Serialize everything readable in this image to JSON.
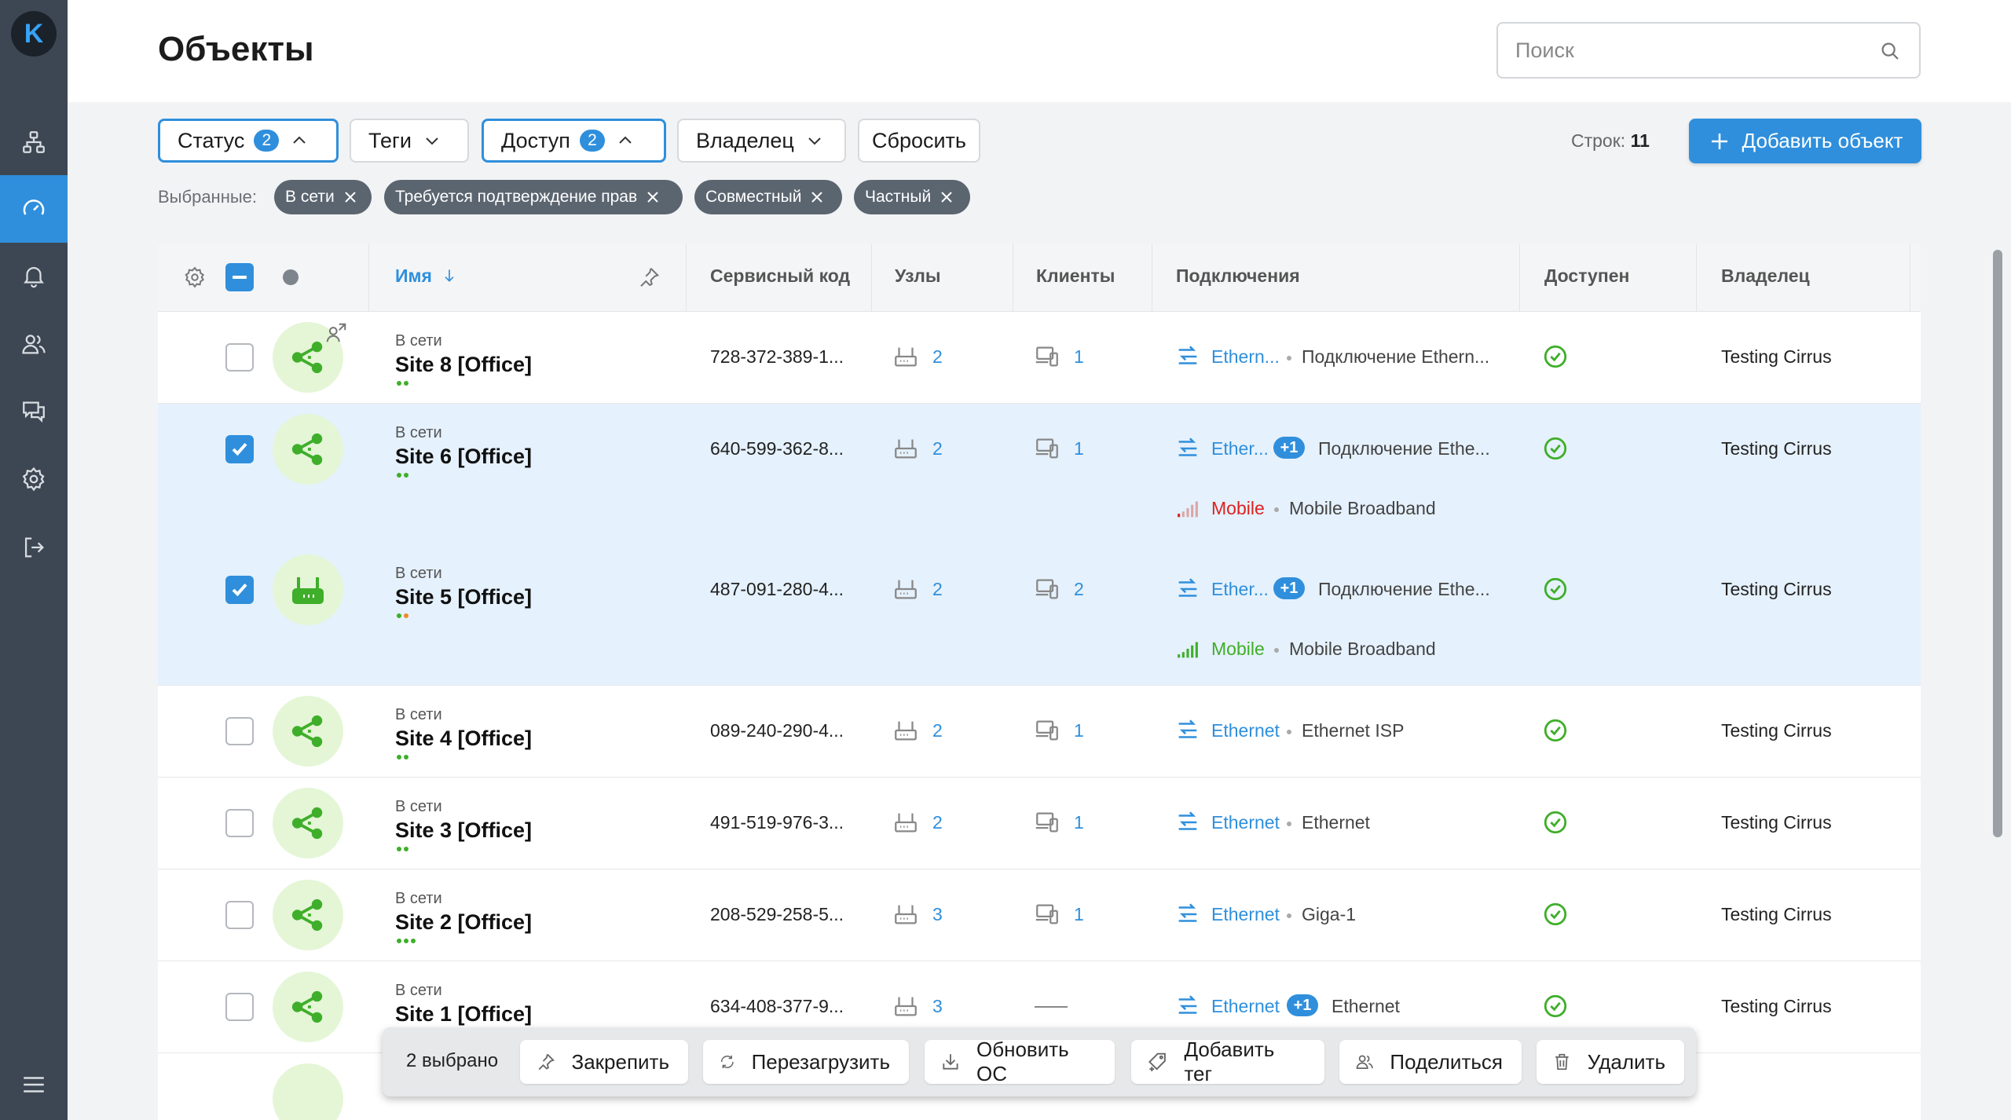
{
  "app": {
    "logo_letter": "K"
  },
  "header": {
    "title": "Объекты",
    "search_placeholder": "Поиск"
  },
  "filters": {
    "status": {
      "label": "Статус",
      "count": "2"
    },
    "tags": {
      "label": "Теги"
    },
    "access": {
      "label": "Доступ",
      "count": "2"
    },
    "owner": {
      "label": "Владелец"
    },
    "reset": "Сбросить",
    "rows_label": "Строк:",
    "rows_value": "11",
    "add_label": "Добавить объект"
  },
  "selected": {
    "label": "Выбранные:",
    "tags": [
      "В сети",
      "Требуется подтверждение прав",
      "Совместный",
      "Частный"
    ]
  },
  "table": {
    "columns": {
      "name": "Имя",
      "service_code": "Сервисный код",
      "nodes": "Узлы",
      "clients": "Клиенты",
      "connections": "Подключения",
      "available": "Доступен",
      "owner": "Владелец"
    },
    "rows": [
      {
        "status": "В сети",
        "name": "Site 8 [Office]",
        "code": "728-372-389-1...",
        "nodes": "2",
        "clients": "1",
        "conn1_type": "Ethern...",
        "conn1_name": "Подключение Ethern...",
        "owner": "Testing Cirrus"
      },
      {
        "status": "В сети",
        "name": "Site 6 [Office]",
        "code": "640-599-362-8...",
        "nodes": "2",
        "clients": "1",
        "conn1_type": "Ether...",
        "conn1_plus": "+1",
        "conn1_name": "Подключение Ethe...",
        "conn2_type": "Mobile",
        "conn2_name": "Mobile Broadband",
        "owner": "Testing Cirrus"
      },
      {
        "status": "В сети",
        "name": "Site 5 [Office]",
        "code": "487-091-280-4...",
        "nodes": "2",
        "clients": "2",
        "conn1_type": "Ether...",
        "conn1_plus": "+1",
        "conn1_name": "Подключение Ethe...",
        "conn2_type": "Mobile",
        "conn2_name": "Mobile Broadband",
        "owner": "Testing Cirrus"
      },
      {
        "status": "В сети",
        "name": "Site 4 [Office]",
        "code": "089-240-290-4...",
        "nodes": "2",
        "clients": "1",
        "conn1_type": "Ethernet",
        "conn1_name": "Ethernet ISP",
        "owner": "Testing Cirrus"
      },
      {
        "status": "В сети",
        "name": "Site 3 [Office]",
        "code": "491-519-976-3...",
        "nodes": "2",
        "clients": "1",
        "conn1_type": "Ethernet",
        "conn1_name": "Ethernet",
        "owner": "Testing Cirrus"
      },
      {
        "status": "В сети",
        "name": "Site 2 [Office]",
        "code": "208-529-258-5...",
        "nodes": "3",
        "clients": "1",
        "conn1_type": "Ethernet",
        "conn1_name": "Giga-1",
        "owner": "Testing Cirrus"
      },
      {
        "status": "В сети",
        "name": "Site 1 [Office]",
        "code": "634-408-377-9...",
        "nodes": "3",
        "clients": "",
        "conn1_type": "Ethernet",
        "conn1_plus": "+1",
        "conn1_name": "Ethernet",
        "owner": "Testing Cirrus"
      }
    ]
  },
  "bulk": {
    "count_label": "2 выбрано",
    "pin": "Закрепить",
    "reboot": "Перезагрузить",
    "update_os": "Обновить ОС",
    "add_tag": "Добавить тег",
    "share": "Поделиться",
    "delete": "Удалить"
  },
  "colors": {
    "accent": "#2f8fdc",
    "online": "#3fae2a",
    "sidebar": "#3d4753"
  }
}
